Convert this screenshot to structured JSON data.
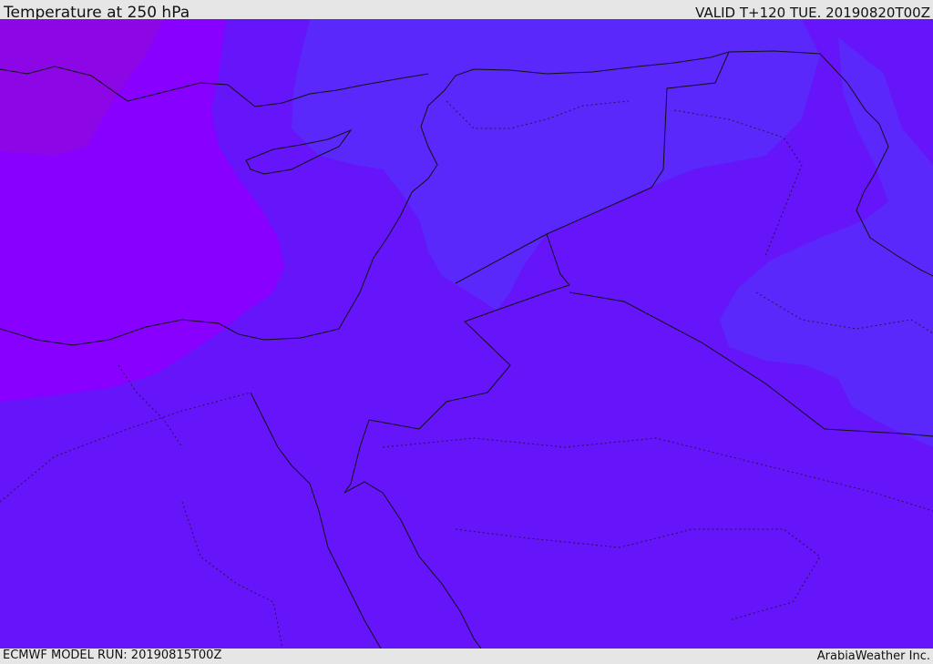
{
  "header": {
    "title": "Temperature at 250 hPa",
    "valid_time": "VALID T+120 TUE. 20190820T00Z"
  },
  "footer": {
    "model_run": "ECMWF MODEL RUN: 20190815T00Z",
    "credit": "ArabiaWeather Inc."
  },
  "map": {
    "region": "Eastern Mediterranean / Middle East",
    "colors": {
      "violet_warm": "#8800ff",
      "purple_base": "#6614fa",
      "blue_cool": "#5a28fa",
      "darker_west": "#8c06e6"
    }
  }
}
